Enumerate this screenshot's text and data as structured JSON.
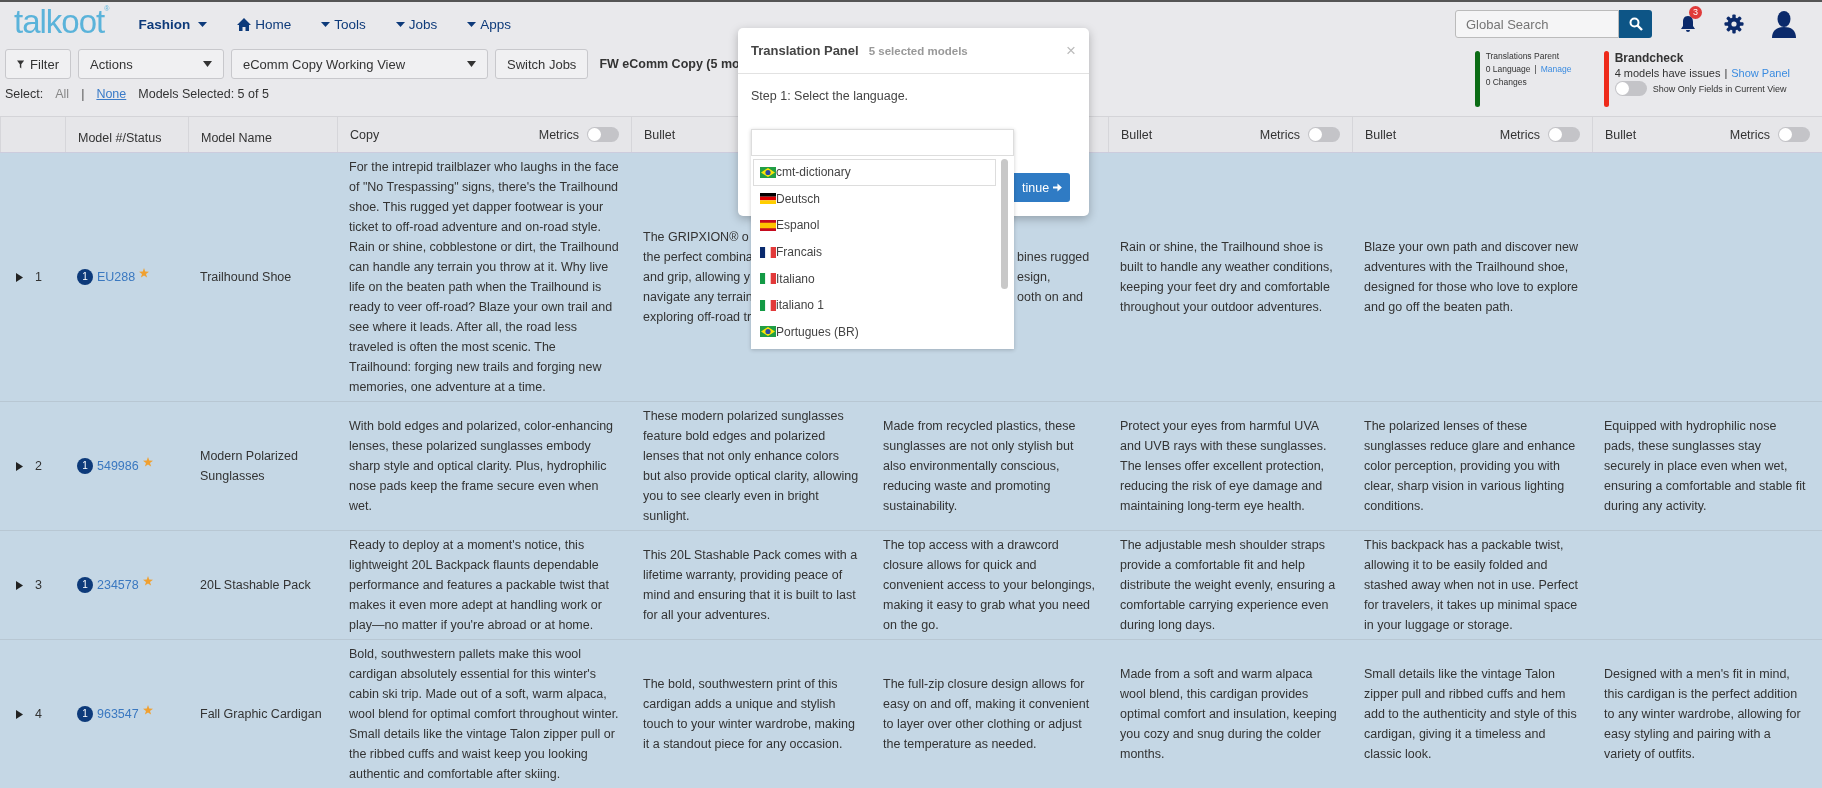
{
  "nav": {
    "logo": "talkoot",
    "logo_mark": "®",
    "menus": [
      {
        "label": "Fashion",
        "kind": "section"
      },
      {
        "label": "Home",
        "kind": "home"
      },
      {
        "label": "Tools",
        "kind": "menu"
      },
      {
        "label": "Jobs",
        "kind": "menu"
      },
      {
        "label": "Apps",
        "kind": "menu"
      }
    ]
  },
  "search": {
    "placeholder": "Global Search"
  },
  "notifications": {
    "count": "3"
  },
  "toolbar": {
    "filter": "Filter",
    "actions": "Actions",
    "view": "eComm Copy Working View",
    "switch_jobs": "Switch Jobs",
    "job_title": "FW eComm Copy (5 mo"
  },
  "selection": {
    "label": "Select:",
    "all": "All",
    "separator": "|",
    "none": "None",
    "summary": "Models Selected: 5 of 5"
  },
  "translations": {
    "title": "Translations Parent",
    "language": "0 Language",
    "separator": "|",
    "manage": "Manage",
    "changes": "0 Changes"
  },
  "brandcheck": {
    "title": "Brandcheck",
    "issues": "4 models have issues",
    "separator": "|",
    "show_panel": "Show Panel",
    "toggle_label": "Show Only Fields in Current View",
    "toggle_on": false
  },
  "table": {
    "fixed_columns": [
      {
        "label": "Model #/Status"
      },
      {
        "label": "Model Name"
      }
    ],
    "columns": [
      {
        "label": "Copy",
        "metrics": "Metrics",
        "metrics_on": false
      },
      {
        "label": "Bullet"
      },
      {},
      {
        "label": "Bullet",
        "metrics": "Metrics",
        "metrics_on": false
      },
      {
        "label": "Bullet",
        "metrics": "Metrics",
        "metrics_on": false
      },
      {
        "label": "Bullet",
        "metrics": "Metrics",
        "metrics_on": false
      }
    ],
    "rows": [
      {
        "number": "1",
        "status": "1",
        "model": "EU288",
        "starred": true,
        "name": "Trailhound Shoe",
        "selected": true,
        "cells": [
          {
            "kind": "text",
            "text": "For the intrepid trailblazer who laughs in the face of \"No Trespassing\" signs, there's the Trailhound shoe. This rugged yet dapper footwear is your ticket to off-road adventure and on-road style. Rain or shine, cobblestone or dirt, the Trailhound can handle any terrain you throw at it. Why live life on the beaten path when the Trailhound is ready to veer off-road? Blaze your own trail and see where it leads. After all, the road less traveled is often the most scenic. The Trailhound: forging new trails and forging new memories, one adventure at a time."
          },
          {
            "kind": "covered-right",
            "lines": [
              "The GRIPXION® o",
              "the perfect combina",
              "and grip, allowing y",
              "navigate any terrain",
              "exploring off-road tr"
            ]
          },
          {
            "kind": "covered-left",
            "lines": [
              "bines rugged",
              "esign,",
              "ooth on and"
            ]
          },
          {
            "kind": "text",
            "text": "Rain or shine, the Trailhound shoe is built to handle any weather conditions, keeping your feet dry and comfortable throughout your outdoor adventures."
          },
          {
            "kind": "text",
            "text": "Blaze your own path and discover new adventures with the Trailhound shoe, designed for those who love to explore and go off the beaten path."
          }
        ]
      },
      {
        "number": "2",
        "status": "1",
        "model": "549986",
        "starred": true,
        "name": "Modern Polarized Sunglasses",
        "selected": true,
        "cells": [
          {
            "kind": "text",
            "text": "With bold edges and polarized, color-enhancing lenses, these polarized sunglasses embody sharp style and optical clarity. Plus, hydrophilic nose pads keep the frame secure even when wet."
          },
          {
            "kind": "text",
            "text": "These modern polarized sunglasses feature bold edges and polarized lenses that not only enhance colors but also provide optical clarity, allowing you to see clearly even in bright sunlight."
          },
          {
            "kind": "text",
            "text": "Made from recycled plastics, these sunglasses are not only stylish but also environmentally conscious, reducing waste and promoting sustainability."
          },
          {
            "kind": "text",
            "text": "Protect your eyes from harmful UVA and UVB rays with these sunglasses. The lenses offer excellent protection, reducing the risk of eye damage and maintaining long-term eye health."
          },
          {
            "kind": "text",
            "text": "The polarized lenses of these sunglasses reduce glare and enhance color perception, providing you with clear, sharp vision in various lighting conditions."
          },
          {
            "kind": "text",
            "text": "Equipped with hydrophilic nose pads, these sunglasses stay securely in place even when wet, ensuring a comfortable and stable fit during any activity."
          }
        ]
      },
      {
        "number": "3",
        "status": "1",
        "model": "234578",
        "starred": true,
        "name": "20L Stashable Pack",
        "selected": true,
        "cells": [
          {
            "kind": "text",
            "text": "Ready to deploy at a moment's notice, this lightweight 20L Backpack flaunts dependable performance and features a packable twist that makes it even more adept at handling work or play—no matter if you're abroad or at home."
          },
          {
            "kind": "text",
            "text": "This 20L Stashable Pack comes with a lifetime warranty, providing peace of mind and ensuring that it is built to last for all your adventures."
          },
          {
            "kind": "text",
            "text": "The top access with a drawcord closure allows for quick and convenient access to your belongings, making it easy to grab what you need on the go."
          },
          {
            "kind": "text",
            "text": "The adjustable mesh shoulder straps provide a comfortable fit and help distribute the weight evenly, ensuring a comfortable carrying experience even during long days."
          },
          {
            "kind": "text",
            "text": "This backpack has a packable twist, allowing it to be easily folded and stashed away when not in use. Perfect for travelers, it takes up minimal space in your luggage or storage."
          }
        ]
      },
      {
        "number": "4",
        "status": "1",
        "model": "963547",
        "starred": true,
        "name": "Fall Graphic Cardigan",
        "selected": true,
        "cells": [
          {
            "kind": "text",
            "text": "Bold, southwestern pallets make this wool cardigan absolutely essential for this winter's cabin ski trip. Made out of a soft, warm alpaca, wool blend for optimal comfort throughout winter. Small details like the vintage Talon zipper pull or the ribbed cuffs and waist keep you looking authentic and comfortable after skiing."
          },
          {
            "kind": "text",
            "text": "The bold, southwestern print of this cardigan adds a unique and stylish touch to your winter wardrobe, making it a standout piece for any occasion."
          },
          {
            "kind": "text",
            "text": "The full-zip closure design allows for easy on and off, making it convenient to layer over other clothing or adjust the temperature as needed."
          },
          {
            "kind": "text",
            "text": "Made from a soft and warm alpaca wool blend, this cardigan provides optimal comfort and insulation, keeping you cozy and snug during the colder months."
          },
          {
            "kind": "text",
            "text": "Small details like the vintage Talon zipper pull and ribbed cuffs and hem add to the authenticity and style of this cardigan, giving it a timeless and classic look."
          },
          {
            "kind": "text",
            "text": "Designed with a men's fit in mind, this cardigan is the perfect addition to any winter wardrobe, allowing for easy styling and pairing with a variety of outfits."
          }
        ]
      }
    ]
  },
  "modal": {
    "title": "Translation Panel",
    "subtitle": "5 selected models",
    "close": "×",
    "step": "Step 1: Select the language.",
    "continue": "tinue",
    "languages": [
      {
        "label": "cmt-dictionary",
        "kind": "br",
        "selected": true
      },
      {
        "label": "Deutsch",
        "kind": "de",
        "selected": false
      },
      {
        "label": "Espanol",
        "kind": "es",
        "selected": false
      },
      {
        "label": "Francais",
        "kind": "fr",
        "selected": false
      },
      {
        "label": "Italiano",
        "kind": "it",
        "selected": false
      },
      {
        "label": "italiano 1",
        "kind": "it",
        "selected": false
      },
      {
        "label": "Portugues (BR)",
        "kind": "br",
        "selected": false
      }
    ]
  }
}
